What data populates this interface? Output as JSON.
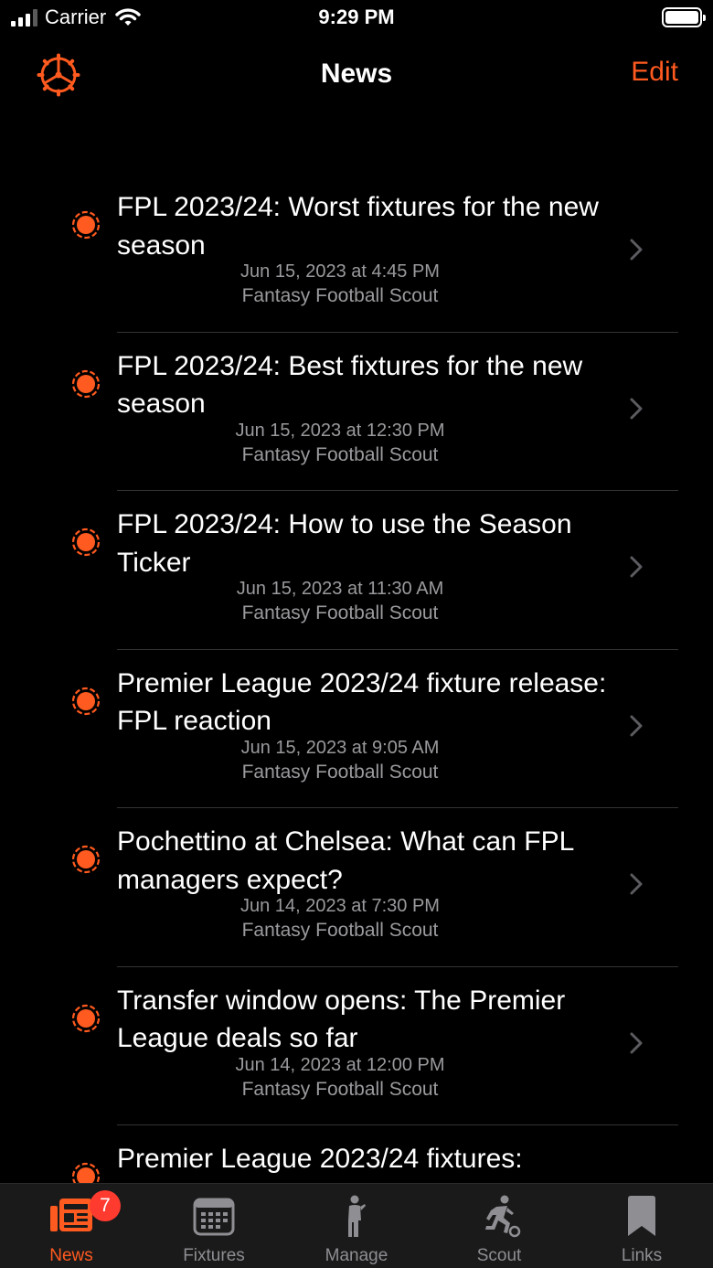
{
  "status_bar": {
    "carrier": "Carrier",
    "time": "9:29 PM"
  },
  "nav": {
    "title": "News",
    "edit_label": "Edit",
    "settings_icon": "gear-icon"
  },
  "colors": {
    "accent": "#ff5a1f",
    "badge": "#ff3b30",
    "secondary_text": "#9a9a9e"
  },
  "news": [
    {
      "title": "FPL 2023/24: Worst fixtures for the new season",
      "date": "Jun 15, 2023 at 4:45 PM",
      "source": "Fantasy Football Scout"
    },
    {
      "title": "FPL 2023/24: Best fixtures for the new season",
      "date": "Jun 15, 2023 at 12:30 PM",
      "source": "Fantasy Football Scout"
    },
    {
      "title": "FPL 2023/24: How to use the Season Ticker",
      "date": "Jun 15, 2023 at 11:30 AM",
      "source": "Fantasy Football Scout"
    },
    {
      "title": "Premier League 2023/24 fixture release: FPL reaction",
      "date": "Jun 15, 2023 at 9:05 AM",
      "source": "Fantasy Football Scout"
    },
    {
      "title": "Pochettino at Chelsea: What can FPL managers expect?",
      "date": "Jun 14, 2023 at 7:30 PM",
      "source": "Fantasy Football Scout"
    },
    {
      "title": "Transfer window opens: The Premier League deals so far",
      "date": "Jun 14, 2023 at 12:00 PM",
      "source": "Fantasy Football Scout"
    },
    {
      "title": "Premier League 2023/24 fixtures:",
      "date": "",
      "source": ""
    }
  ],
  "tabs": [
    {
      "label": "News",
      "icon": "newspaper-icon",
      "active": true,
      "badge": "7"
    },
    {
      "label": "Fixtures",
      "icon": "calendar-icon",
      "active": false
    },
    {
      "label": "Manage",
      "icon": "manager-figure-icon",
      "active": false
    },
    {
      "label": "Scout",
      "icon": "running-player-icon",
      "active": false
    },
    {
      "label": "Links",
      "icon": "bookmark-icon",
      "active": false
    }
  ]
}
